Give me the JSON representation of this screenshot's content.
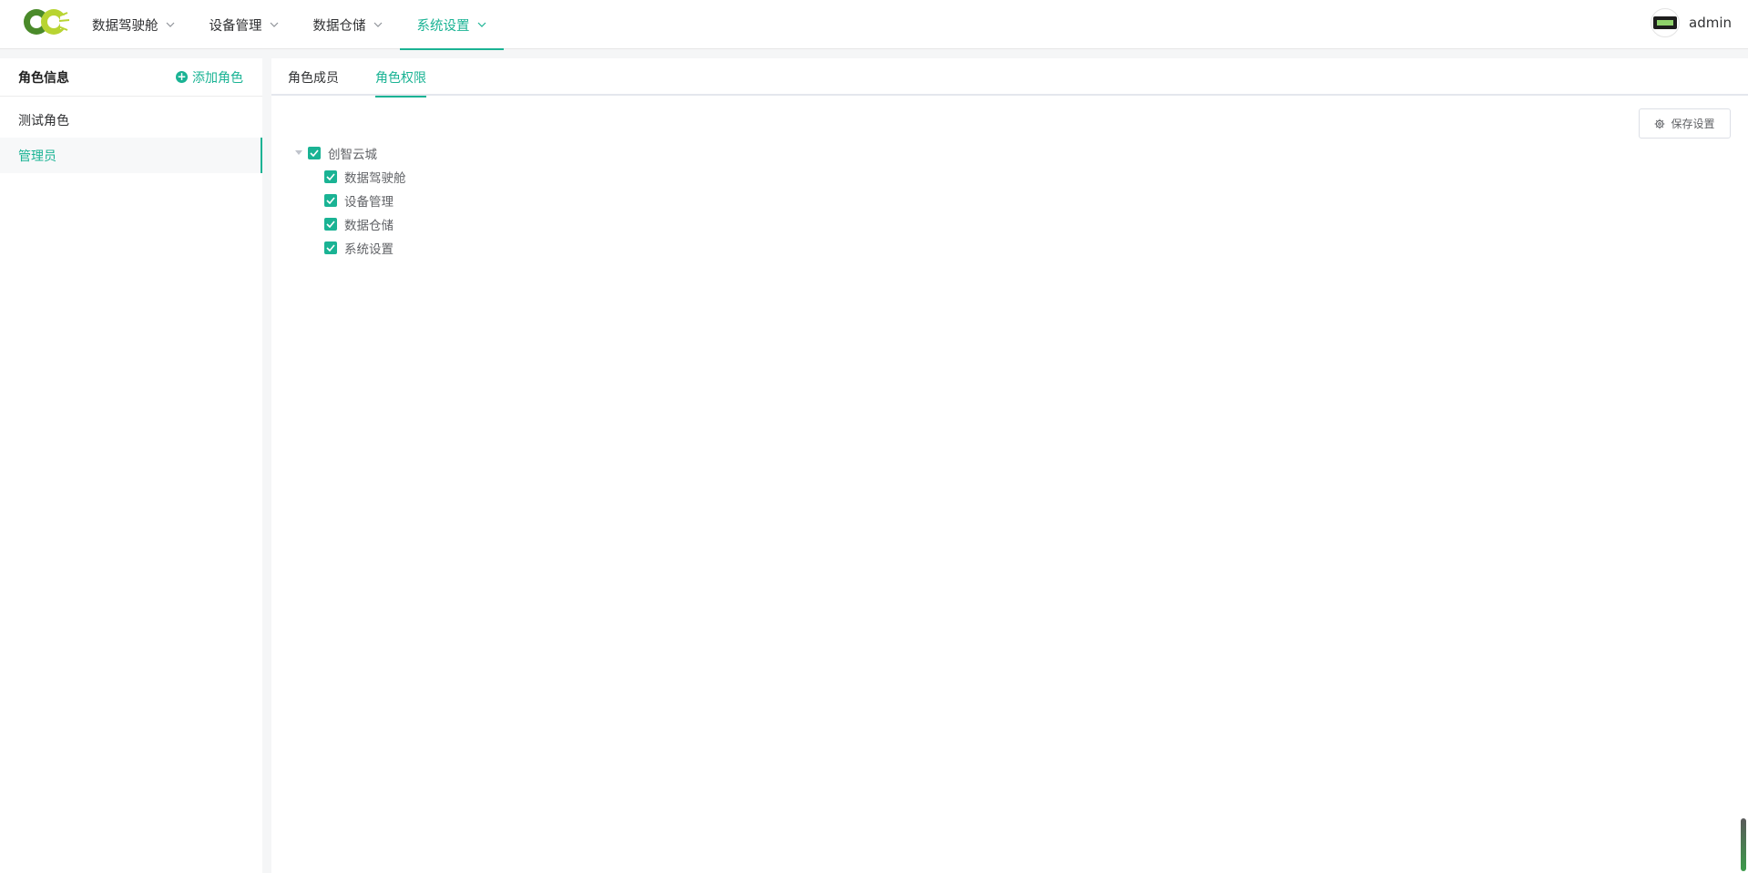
{
  "header": {
    "nav": [
      {
        "label": "数据驾驶舱",
        "active": false
      },
      {
        "label": "设备管理",
        "active": false
      },
      {
        "label": "数据仓储",
        "active": false
      },
      {
        "label": "系统设置",
        "active": true
      }
    ],
    "user": {
      "name": "admin"
    }
  },
  "left": {
    "title": "角色信息",
    "add_label": "添加角色",
    "roles": [
      {
        "label": "测试角色",
        "active": false
      },
      {
        "label": "管理员",
        "active": true
      }
    ]
  },
  "right": {
    "tabs": [
      {
        "label": "角色成员",
        "active": false
      },
      {
        "label": "角色权限",
        "active": true
      }
    ],
    "save_label": "保存设置",
    "tree": {
      "root": {
        "label": "创智云城",
        "checked": true,
        "expanded": true
      },
      "children": [
        {
          "label": "数据驾驶舱",
          "checked": true
        },
        {
          "label": "设备管理",
          "checked": true
        },
        {
          "label": "数据仓储",
          "checked": true
        },
        {
          "label": "系统设置",
          "checked": true
        }
      ]
    }
  },
  "colors": {
    "accent": "#1ab394",
    "logo_dark_green": "#4a8a2a",
    "logo_yellow_green": "#b8d432"
  },
  "icons": {
    "logo": "cc-logo",
    "nav_chevron": "chevron-down-icon",
    "add": "plus-circle-icon",
    "save": "gear-icon",
    "tree_caret": "caret-down-icon",
    "checkbox": "checkbox-checked-icon"
  }
}
